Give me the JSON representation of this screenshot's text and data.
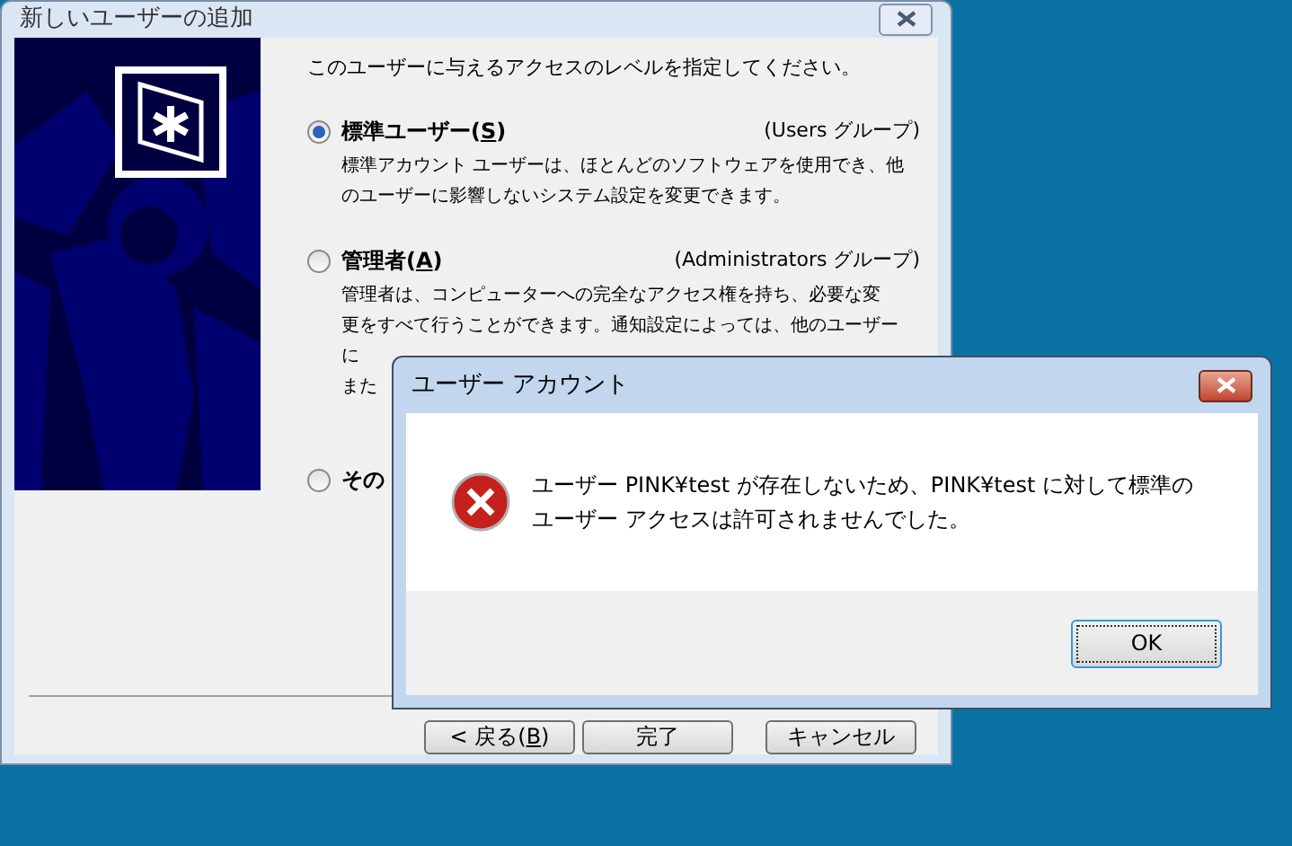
{
  "window": {
    "title": "新しいユーザーの追加"
  },
  "prompt": "このユーザーに与えるアクセスのレベルを指定してください。",
  "options": [
    {
      "label_before": "標準ユーザー(",
      "access_key": "S",
      "label_after": ")",
      "group": "(Users グループ)",
      "description": [
        "標準アカウント ユーザーは、ほとんどのソフトウェアを使用でき、他",
        "のユーザーに影響しないシステム設定を変更できます。"
      ],
      "selected": true
    },
    {
      "label_before": "管理者(",
      "access_key": "A",
      "label_after": ")",
      "group": "(Administrators グループ)",
      "description": [
        "管理者は、コンピューターへの完全なアクセス権を持ち、必要な変",
        "更をすべて行うことができます。通知設定によっては、他のユーザー",
        "に",
        "また"
      ],
      "selected": false
    },
    {
      "label_before": "その",
      "selected": false
    }
  ],
  "buttons": [
    {
      "label_before": "< 戻る(",
      "access_key": "B",
      "label_after": ")"
    },
    {
      "label_before": "完了"
    },
    {
      "label_before": "キャンセル"
    }
  ],
  "error_dialog": {
    "title": "ユーザー アカウント",
    "message": [
      "ユーザー PINK¥test が存在しないため、PINK¥test に対して標準の",
      "ユーザー アクセスは許可されませんでした。"
    ],
    "button": "OK"
  }
}
